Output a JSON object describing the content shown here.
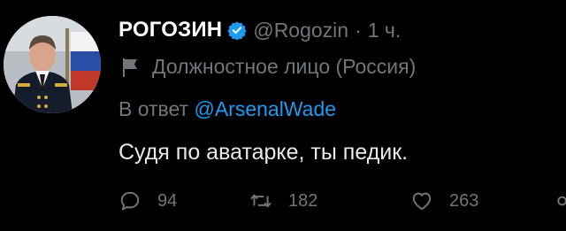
{
  "tweet": {
    "author": {
      "name": "РОГОЗИН",
      "handle": "@Rogozin",
      "separator": "·",
      "time": "1 ч."
    },
    "affiliation": "Должностное лицо (Россия)",
    "reply_prefix": "В ответ",
    "reply_mention": "@ArsenalWade",
    "text": "Судя по аватарке, ты педик.",
    "stats": {
      "replies": "94",
      "retweets": "182",
      "likes": "263"
    }
  },
  "colors": {
    "background": "#000000",
    "primary_text": "#e7e9ea",
    "secondary_text": "#71767b",
    "accent": "#1d9bf0"
  },
  "icons": [
    "verified-badge-icon",
    "flag-icon",
    "reply-icon",
    "retweet-icon",
    "like-icon",
    "share-icon"
  ]
}
